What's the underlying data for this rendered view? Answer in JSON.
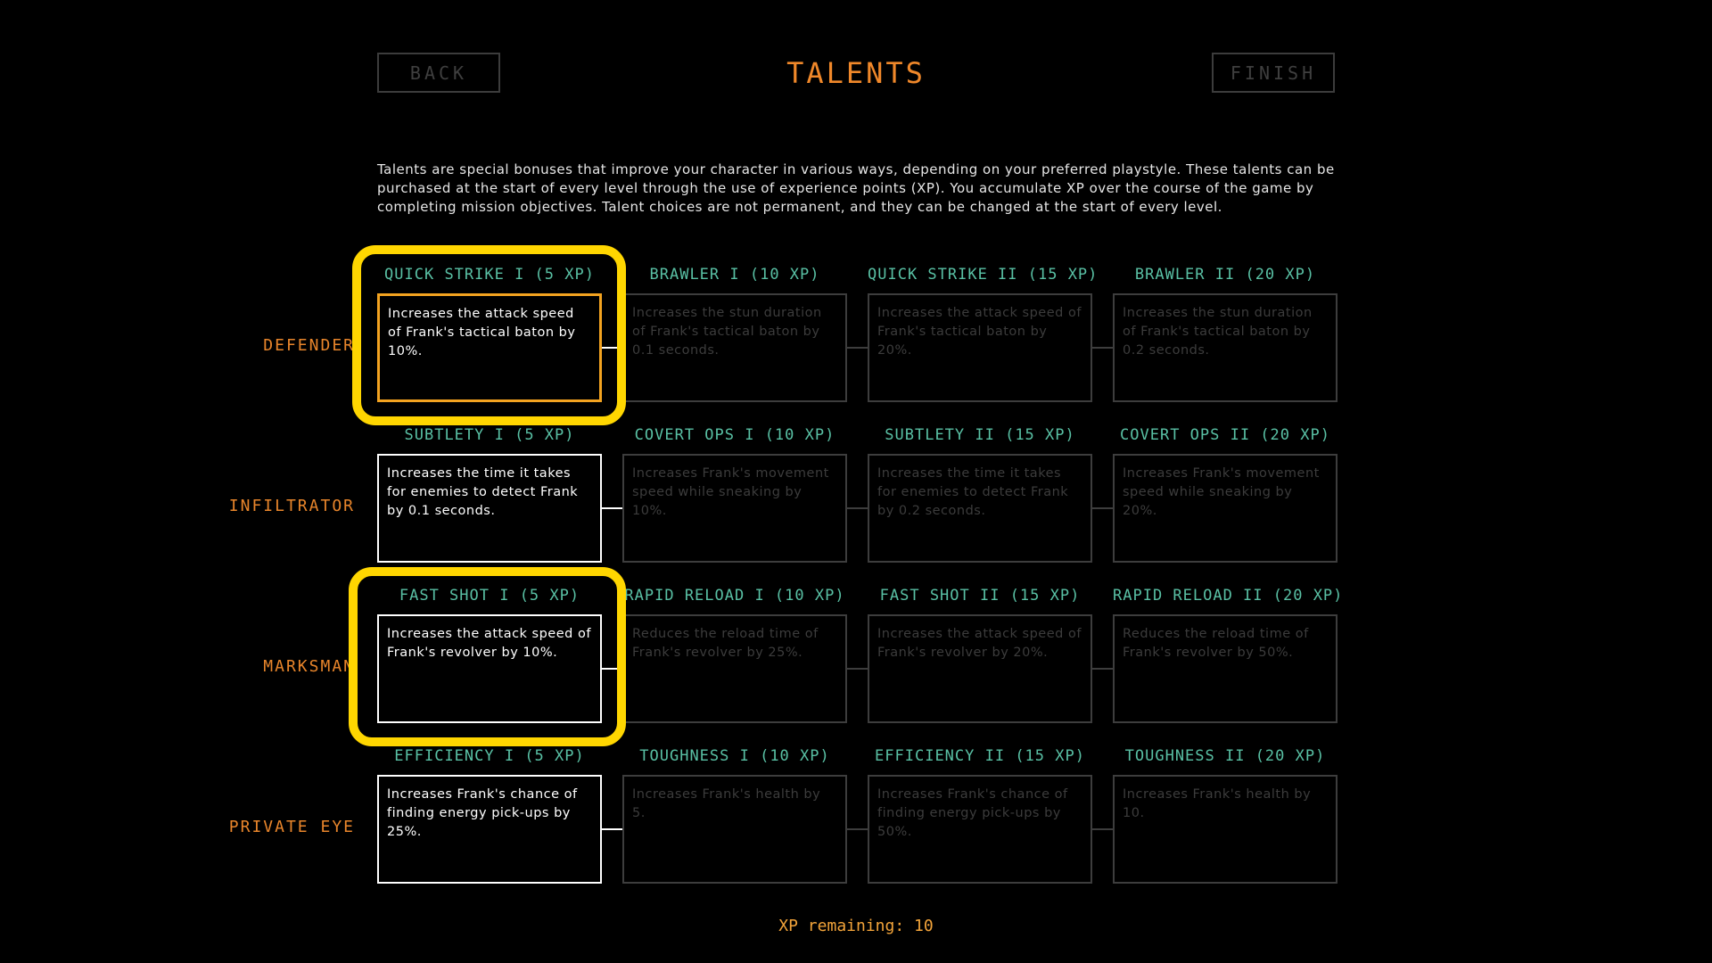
{
  "header": {
    "back_label": "BACK",
    "title": "TALENTS",
    "finish_label": "FINISH"
  },
  "description": "Talents are special bonuses that improve your character in various ways, depending on your preferred playstyle. These talents can be purchased at the start of every level through the use of experience points (XP). You accumulate XP over the course of the game by completing mission objectives. Talent choices are not permanent, and they can be changed at the start of every level.",
  "rows": [
    {
      "label": "DEFENDER",
      "talents": [
        {
          "name": "QUICK STRIKE I (5 XP)",
          "desc": "Increases the attack speed of Frank's tactical baton by 10%.",
          "state": "selected"
        },
        {
          "name": "BRAWLER I (10 XP)",
          "desc": "Increases the stun duration of Frank's tactical baton by 0.1 seconds.",
          "state": "locked"
        },
        {
          "name": "QUICK STRIKE II (15 XP)",
          "desc": "Increases the attack speed of Frank's tactical baton by 20%.",
          "state": "locked"
        },
        {
          "name": "BRAWLER II (20 XP)",
          "desc": "Increases the stun duration of Frank's tactical baton by 0.2 seconds.",
          "state": "locked"
        }
      ]
    },
    {
      "label": "INFILTRATOR",
      "talents": [
        {
          "name": "SUBTLETY I (5 XP)",
          "desc": "Increases the time it takes for enemies to detect Frank by 0.1 seconds.",
          "state": "available"
        },
        {
          "name": "COVERT OPS I (10 XP)",
          "desc": "Increases Frank's movement speed while sneaking by 10%.",
          "state": "locked"
        },
        {
          "name": "SUBTLETY II (15 XP)",
          "desc": "Increases the time it takes for enemies to detect Frank by 0.2 seconds.",
          "state": "locked"
        },
        {
          "name": "COVERT OPS II (20 XP)",
          "desc": "Increases Frank's movement speed while sneaking by 20%.",
          "state": "locked"
        }
      ]
    },
    {
      "label": "MARKSMAN",
      "talents": [
        {
          "name": "FAST SHOT I (5 XP)",
          "desc": "Increases the attack speed of Frank's revolver by 10%.",
          "state": "available"
        },
        {
          "name": "RAPID RELOAD I (10 XP)",
          "desc": "Reduces the reload time of Frank's revolver by 25%.",
          "state": "locked"
        },
        {
          "name": "FAST SHOT II (15 XP)",
          "desc": "Increases the attack speed of Frank's revolver by 20%.",
          "state": "locked"
        },
        {
          "name": "RAPID RELOAD II (20 XP)",
          "desc": "Reduces the reload time of Frank's revolver by 50%.",
          "state": "locked"
        }
      ]
    },
    {
      "label": "PRIVATE EYE",
      "talents": [
        {
          "name": "EFFICIENCY I (5 XP)",
          "desc": "Increases Frank's chance of finding energy pick-ups by 25%.",
          "state": "available"
        },
        {
          "name": "TOUGHNESS I (10 XP)",
          "desc": "Increases Frank's health by 5.",
          "state": "locked"
        },
        {
          "name": "EFFICIENCY II (15 XP)",
          "desc": "Increases Frank's chance of finding energy pick-ups by 50%.",
          "state": "locked"
        },
        {
          "name": "TOUGHNESS II (20 XP)",
          "desc": "Increases Frank's health by 10.",
          "state": "locked"
        }
      ]
    }
  ],
  "xp_remaining": "XP remaining: 10",
  "colors": {
    "accent_orange": "#f0882a",
    "talent_name_teal": "#59c0a4",
    "selected_border": "#f3a320",
    "highlight_yellow": "#ffd600",
    "locked_gray": "#3d3d3d"
  }
}
